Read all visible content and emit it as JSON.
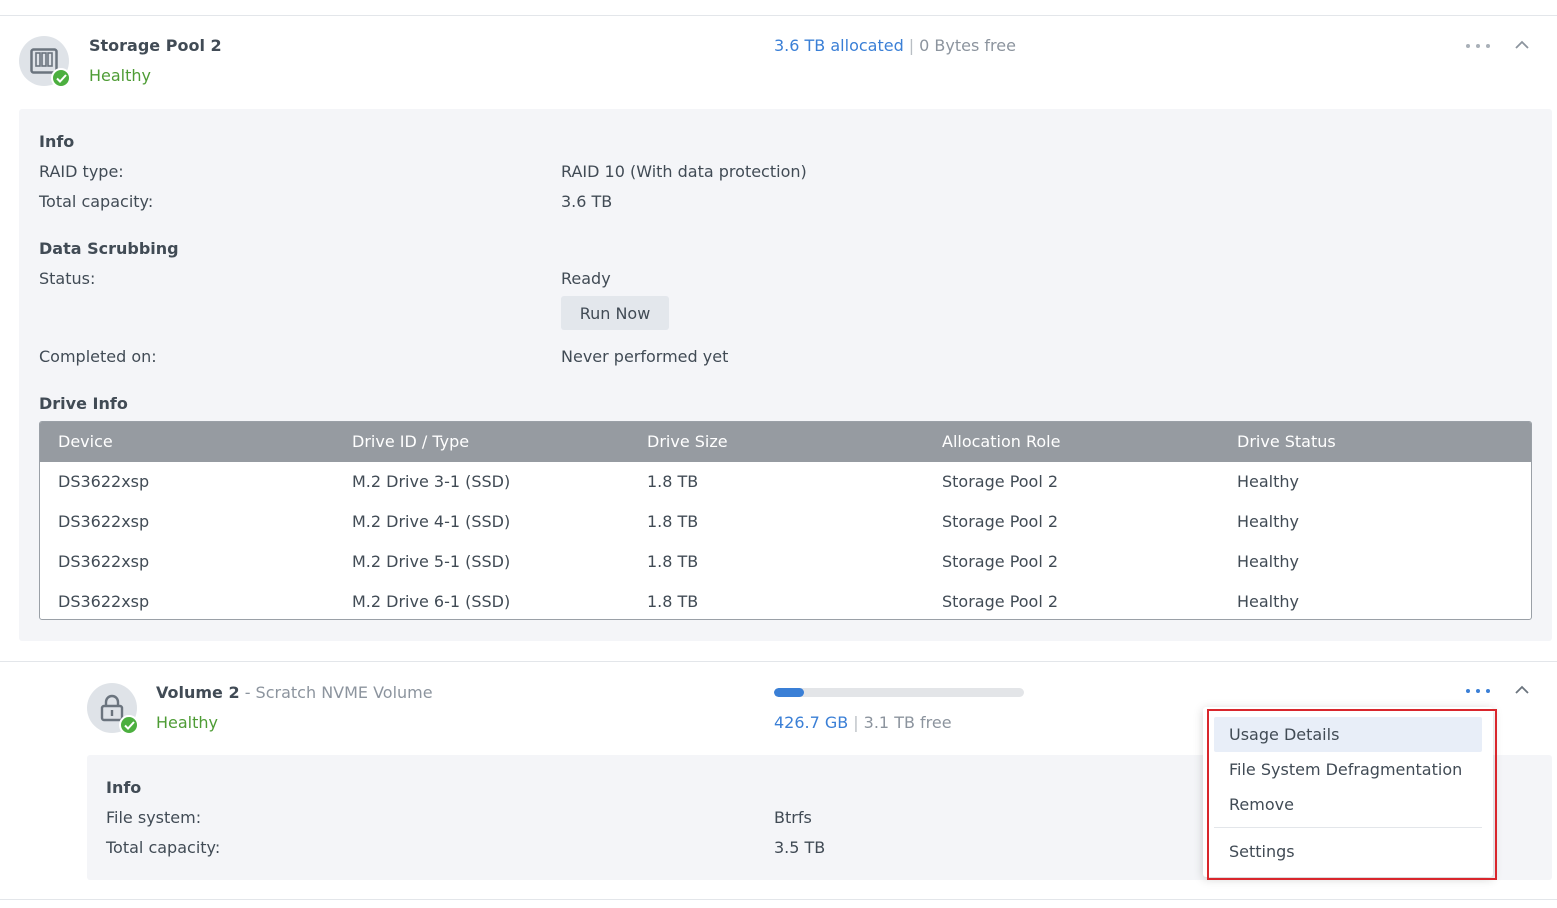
{
  "pool": {
    "name": "Storage Pool 2",
    "status": "Healthy",
    "allocated": "3.6 TB allocated",
    "separator": "|",
    "free": "0 Bytes free",
    "info": {
      "heading": "Info",
      "raid_label": "RAID type:",
      "raid_value": "RAID 10 (With data protection)",
      "capacity_label": "Total capacity:",
      "capacity_value": "3.6 TB"
    },
    "scrubbing": {
      "heading": "Data Scrubbing",
      "status_label": "Status:",
      "status_value": "Ready",
      "run_now_label": "Run Now",
      "completed_label": "Completed on:",
      "completed_value": "Never performed yet"
    },
    "drive_info": {
      "heading": "Drive Info",
      "columns": [
        "Device",
        "Drive ID / Type",
        "Drive Size",
        "Allocation Role",
        "Drive Status"
      ],
      "rows": [
        [
          "DS3622xsp",
          "M.2 Drive 3-1 (SSD)",
          "1.8 TB",
          "Storage Pool 2",
          "Healthy"
        ],
        [
          "DS3622xsp",
          "M.2 Drive 4-1 (SSD)",
          "1.8 TB",
          "Storage Pool 2",
          "Healthy"
        ],
        [
          "DS3622xsp",
          "M.2 Drive 5-1 (SSD)",
          "1.8 TB",
          "Storage Pool 2",
          "Healthy"
        ],
        [
          "DS3622xsp",
          "M.2 Drive 6-1 (SSD)",
          "1.8 TB",
          "Storage Pool 2",
          "Healthy"
        ]
      ]
    }
  },
  "volume": {
    "name": "Volume 2",
    "description": " - Scratch NVME Volume",
    "status": "Healthy",
    "used": "426.7 GB",
    "separator": "|",
    "free": "3.1 TB free",
    "usage_fraction": 0.12,
    "info": {
      "heading": "Info",
      "fs_label": "File system:",
      "fs_value": "Btrfs",
      "capacity_label": "Total capacity:",
      "capacity_value": "3.5 TB"
    }
  },
  "context_menu": {
    "items": [
      "Usage Details",
      "File System Defragmentation",
      "Remove",
      "Settings"
    ]
  },
  "colors": {
    "healthy": "#4e9c35",
    "accent": "#3a7fd6",
    "highlight": "#d9262c"
  }
}
